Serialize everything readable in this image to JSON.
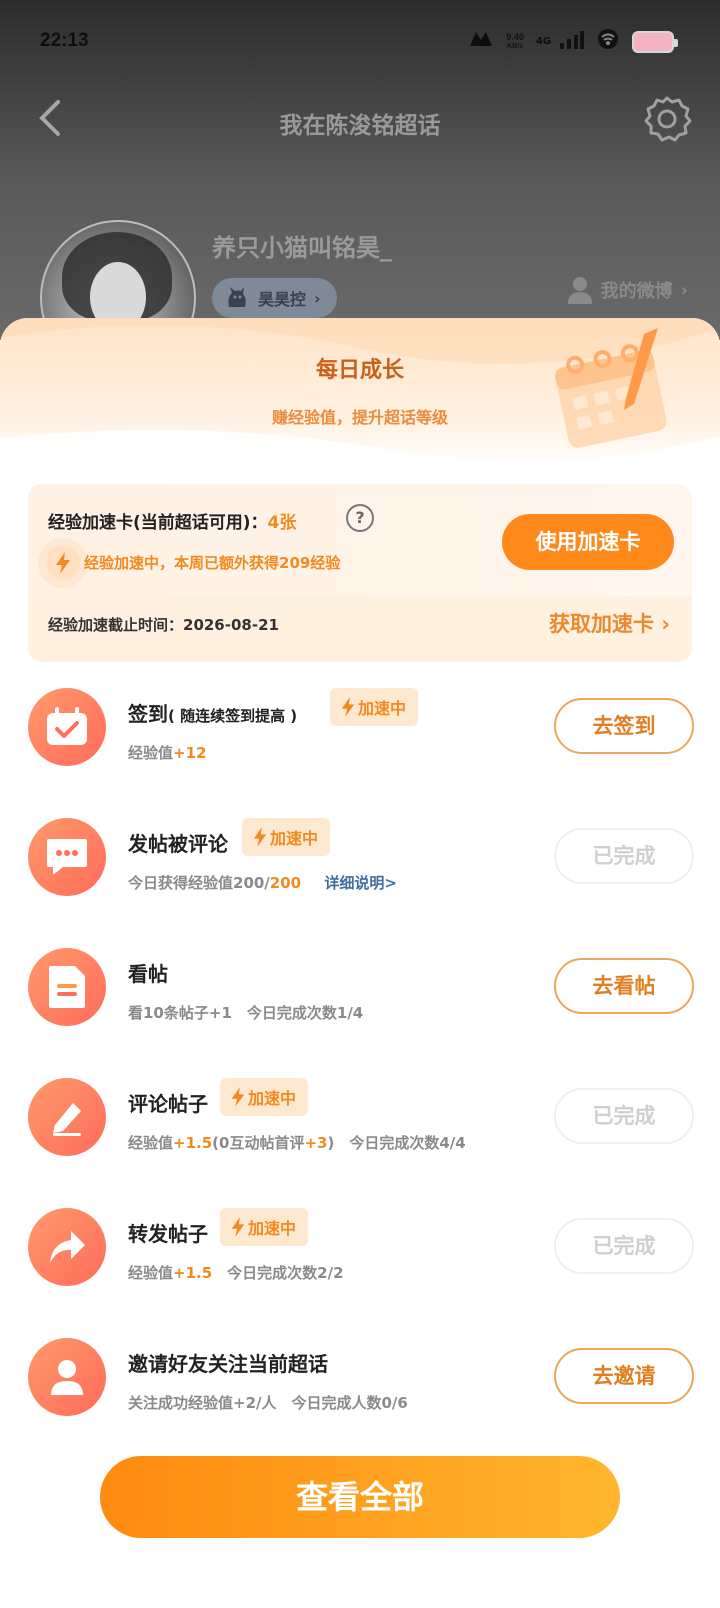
{
  "status": {
    "time": "22:13",
    "speed_value": "9.40",
    "speed_unit": "KB/s",
    "network": "4G"
  },
  "nav": {
    "title": "我在陈浚铭超话"
  },
  "profile": {
    "username": "养只小猫叫铭昊_",
    "fan_badge": "昊昊控",
    "my_weibo": "我的微博"
  },
  "sheet": {
    "title": "每日成长",
    "subtitle": "赚经验值，提升超话等级"
  },
  "boost": {
    "label": "经验加速卡(当前超话可用)：",
    "count": "4张",
    "help": "?",
    "status": "经验加速中，本周已额外获得209经验",
    "use_button": "使用加速卡",
    "deadline": "经验加速截止时间：2026-08-21",
    "get_link": "获取加速卡"
  },
  "boost_tag_label": "加速中",
  "tasks": [
    {
      "title": "签到",
      "hint": "( 随连续签到提高 )",
      "boosted": true,
      "desc_prefix": "经验值",
      "desc_highlight": "+12",
      "desc_rest": "",
      "button": "去签到",
      "done": false,
      "icon": "calendar-check-icon"
    },
    {
      "title": "发帖被评论",
      "hint": "",
      "boosted": true,
      "desc_prefix": "今日获得经验值200/",
      "desc_highlight": "200",
      "desc_link": "详细说明>",
      "button": "已完成",
      "done": true,
      "icon": "chat-bubble-icon"
    },
    {
      "title": "看帖",
      "hint": "",
      "boosted": false,
      "desc_prefix": "看10条帖子+1　今日完成次数1/4",
      "desc_highlight": "",
      "button": "去看帖",
      "done": false,
      "icon": "document-icon"
    },
    {
      "title": "评论帖子",
      "hint": "",
      "boosted": true,
      "desc_prefix": "经验值",
      "desc_highlight": "+1.5",
      "desc_mid": "(0互动帖首评",
      "desc_highlight2": "+3",
      "desc_rest": ")　今日完成次数4/4",
      "button": "已完成",
      "done": true,
      "icon": "edit-pen-icon"
    },
    {
      "title": "转发帖子",
      "hint": "",
      "boosted": true,
      "desc_prefix": "经验值",
      "desc_highlight": "+1.5",
      "desc_rest": "　今日完成次数2/2",
      "button": "已完成",
      "done": true,
      "icon": "share-arrow-icon"
    },
    {
      "title": "邀请好友关注当前超话",
      "hint": "",
      "boosted": false,
      "desc_prefix": "关注成功经验值+2/人　今日完成人数0/6",
      "desc_highlight": "",
      "button": "去邀请",
      "done": false,
      "icon": "person-icon"
    }
  ],
  "view_all": "查看全部",
  "colors": {
    "accent": "#ff8a1b",
    "accent_text": "#f28a1f",
    "title_brown": "#c9611a",
    "link_blue": "#3f6f9f"
  }
}
